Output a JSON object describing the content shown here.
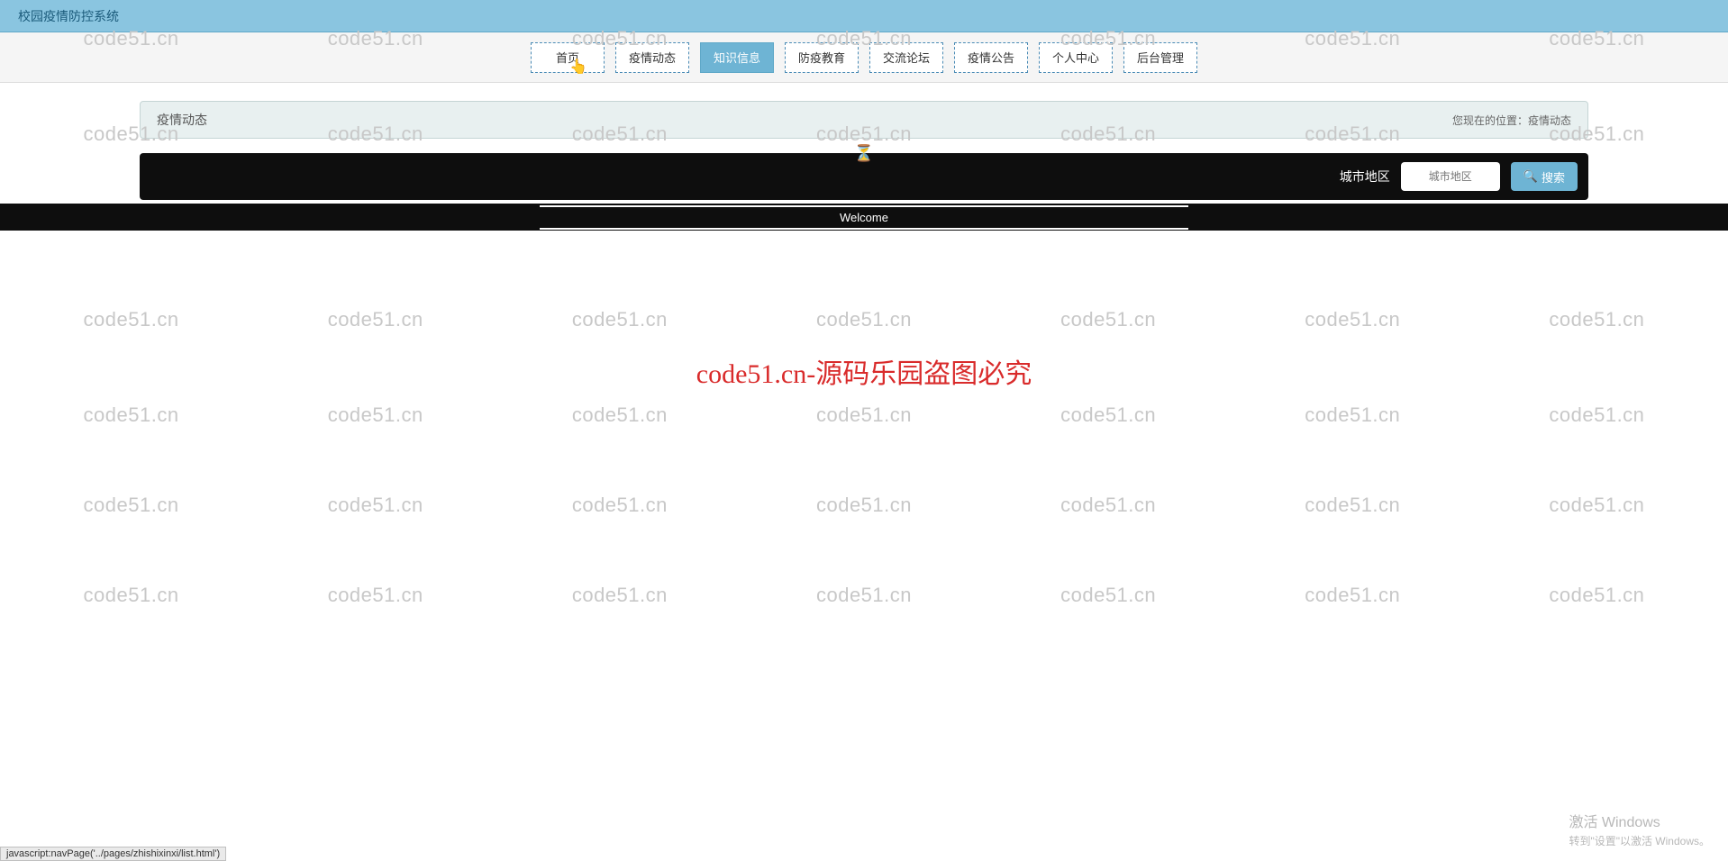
{
  "header": {
    "title": "校园疫情防控系统"
  },
  "nav": {
    "items": [
      {
        "label": "首页"
      },
      {
        "label": "疫情动态"
      },
      {
        "label": "知识信息",
        "active": true
      },
      {
        "label": "防疫教育"
      },
      {
        "label": "交流论坛"
      },
      {
        "label": "疫情公告"
      },
      {
        "label": "个人中心"
      },
      {
        "label": "后台管理"
      }
    ]
  },
  "breadcrumb": {
    "title": "疫情动态",
    "location_prefix": "您现在的位置：",
    "location_current": "疫情动态"
  },
  "search": {
    "label": "城市地区",
    "placeholder": "城市地区",
    "button_label": "搜索"
  },
  "welcome": {
    "text": "Welcome"
  },
  "watermark": {
    "text": "code51.cn"
  },
  "overlay": {
    "text": "code51.cn-源码乐园盗图必究"
  },
  "activate": {
    "line1": "激活 Windows",
    "line2": "转到\"设置\"以激活 Windows。"
  },
  "status": {
    "text": "javascript:navPage('../pages/zhishixinxi/list.html')"
  }
}
